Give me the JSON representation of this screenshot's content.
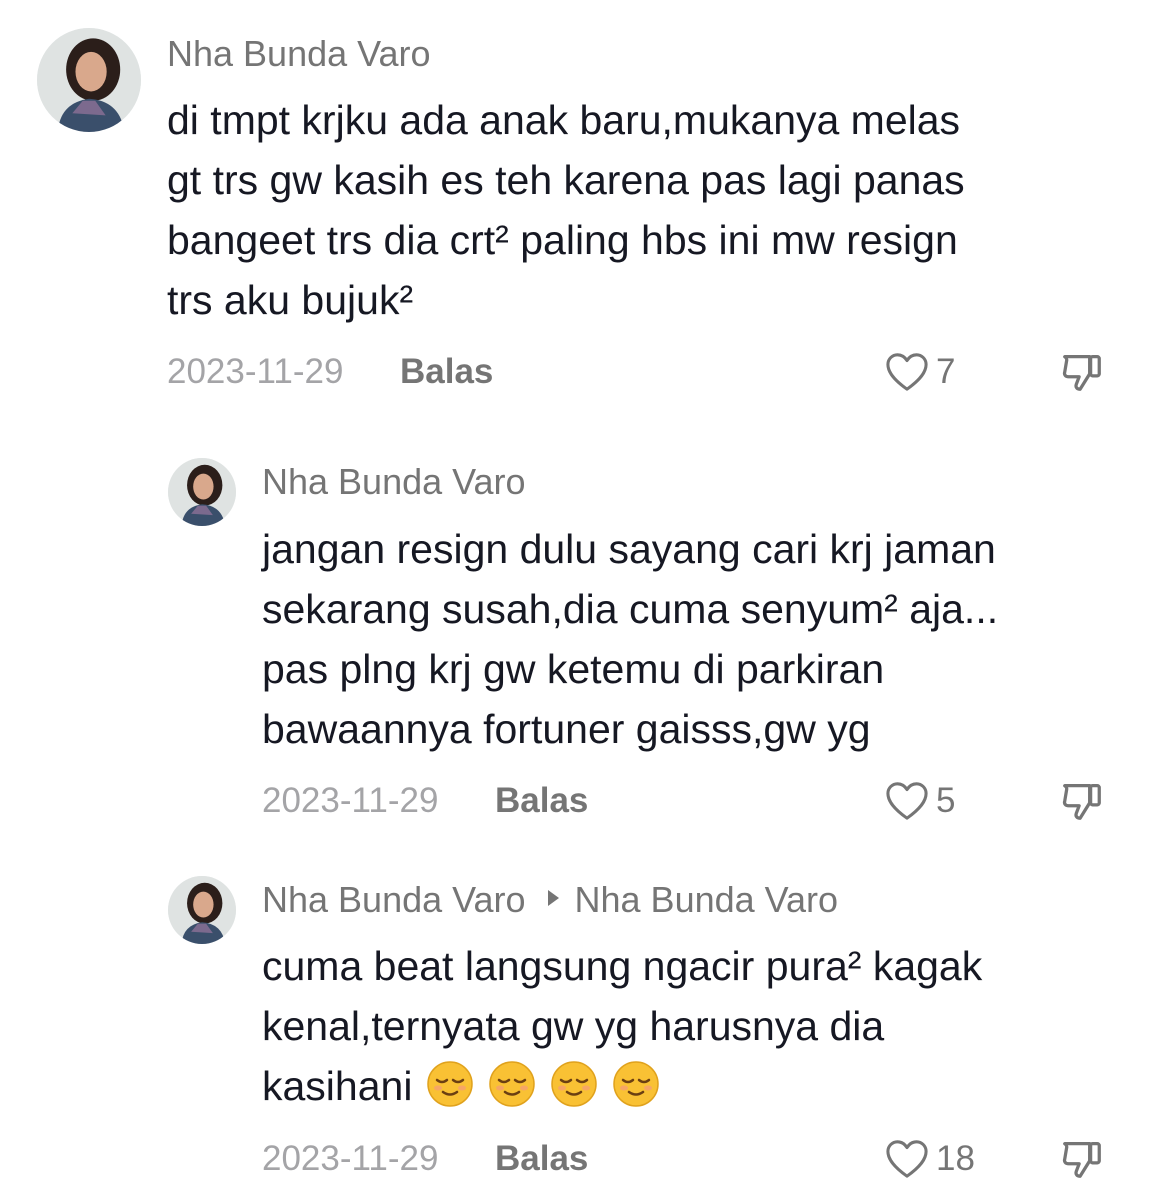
{
  "comments": [
    {
      "username": "Nha Bunda Varo",
      "text": "di tmpt krjku ada anak baru,mukanya melas\ngt trs gw kasih es teh karena pas lagi panas\nbangeet trs dia crt² paling hbs ini mw resign\ntrs aku bujuk²",
      "date": "2023-11-29",
      "reply_label": "Balas",
      "likes": "7"
    },
    {
      "username": "Nha Bunda Varo",
      "text": "jangan resign dulu sayang cari krj jaman\nsekarang susah,dia cuma senyum² aja...\npas plng krj gw ketemu di parkiran\nbawaannya fortuner gaisss,gw yg",
      "date": "2023-11-29",
      "reply_label": "Balas",
      "likes": "5"
    },
    {
      "username": "Nha Bunda Varo",
      "reply_to": "Nha Bunda Varo",
      "text": "cuma beat langsung ngacir pura² kagak\nkenal,ternyata gw yg harusnya dia\nkasihani",
      "emojis": [
        "relieved-face",
        "relieved-face",
        "relieved-face",
        "relieved-face"
      ],
      "date": "2023-11-29",
      "reply_label": "Balas",
      "likes": "18"
    }
  ],
  "icons": {
    "like": "heart-outline-icon",
    "dislike": "thumbs-down-icon",
    "reply_arrow": "triangle-right-icon"
  },
  "colors": {
    "text": "#161823",
    "username": "#757575",
    "date": "#a4a4a7",
    "emoji": "#f9c134"
  }
}
